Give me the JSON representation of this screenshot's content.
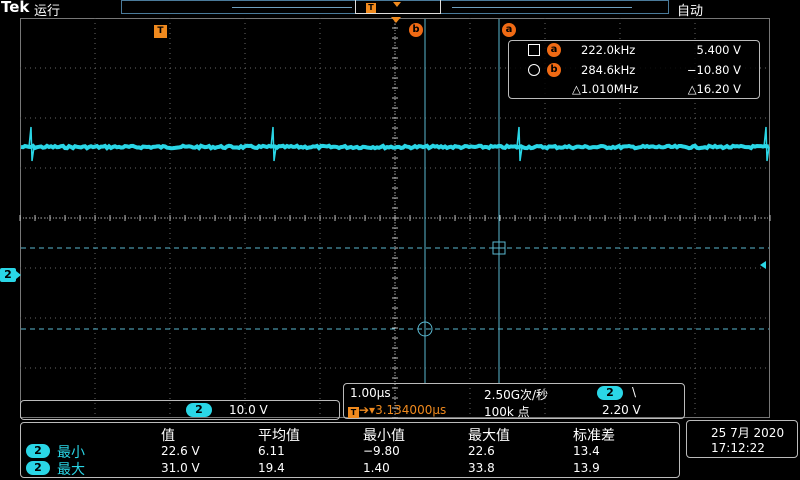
{
  "header": {
    "brand": "Tek",
    "run_state": "运行",
    "trigger_mode": "自动",
    "record_trigger_badge": "T"
  },
  "markers": {
    "trigger_badge": "T",
    "cursor_a": "a",
    "cursor_b": "b",
    "channel": "2"
  },
  "cursor_readout": {
    "a": {
      "label": "a",
      "frequency": "222.0kHz",
      "voltage": "5.400 V"
    },
    "b": {
      "label": "b",
      "frequency": "284.6kHz",
      "voltage": "−10.80 V"
    },
    "delta_frequency": "△1.010MHz",
    "delta_voltage": "△16.20 V"
  },
  "horizontal": {
    "time_per_div": "1.00μs",
    "sample_rate": "2.50G次/秒",
    "trigger_channel": "2",
    "trigger_slope": "\\",
    "trigger_badge": "T",
    "trigger_position": "➔▾3.134000μs",
    "record_length": "100k 点",
    "trigger_level": "2.20 V"
  },
  "vertical": {
    "channel": "2",
    "volts_per_div": "10.0 V"
  },
  "measurements": {
    "headers": [
      "值",
      "平均值",
      "最小值",
      "最大值",
      "标准差"
    ],
    "rows": [
      {
        "channel": "2",
        "name": "最小",
        "values": [
          "22.6 V",
          "6.11",
          "−9.80",
          "22.6",
          "13.4"
        ]
      },
      {
        "channel": "2",
        "name": "最大",
        "values": [
          "31.0 V",
          "19.4",
          "1.40",
          "33.8",
          "13.9"
        ]
      }
    ]
  },
  "datetime": {
    "date": "25 7月 2020",
    "time": "17:12:22"
  },
  "colors": {
    "channel2": "#2ad6e6",
    "trigger": "#f08a1e",
    "cursor": "#f06a14",
    "grid": "#888888",
    "cursor_line": "#5ab8d0"
  }
}
